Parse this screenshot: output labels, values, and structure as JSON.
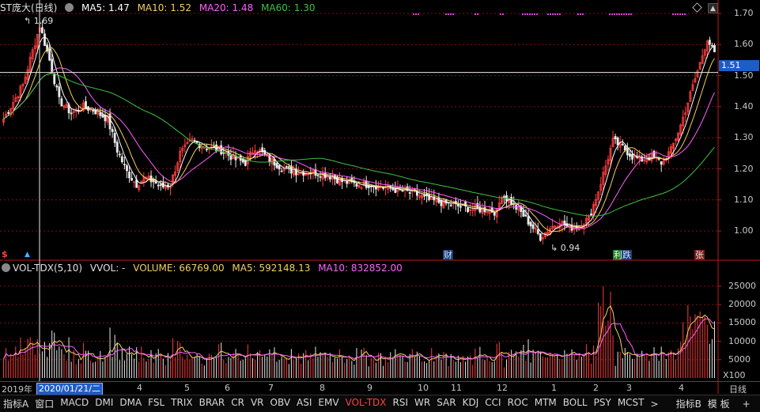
{
  "main_header": {
    "stock": "ST庞大(日线)",
    "ma5": "MA5: 1.47",
    "ma10": "MA10: 1.52",
    "ma20": "MA20: 1.48",
    "ma60": "MA60: 1.30"
  },
  "price_axis": [
    "1.70",
    "1.60",
    "1.50",
    "1.40",
    "1.30",
    "1.20",
    "1.10",
    "1.00"
  ],
  "current_price": "1.51",
  "annotations": {
    "high": "1.69",
    "low": "0.94"
  },
  "markers": {
    "dollar": "$",
    "arrow": "▲",
    "cai": "财",
    "li": "利",
    "die": "跌",
    "zhang": "张"
  },
  "vol_header": {
    "name": "VOL-TDX(5,10)",
    "vvol": "VVOL: -",
    "volume": "VOLUME: 66769.00",
    "ma5": "MA5: 592148.13",
    "ma10": "MA10: 832852.00"
  },
  "vol_axis": [
    "25000",
    "20000",
    "15000",
    "10000",
    "5000"
  ],
  "vol_unit": "X100",
  "date_axis": {
    "year": "2019年",
    "cursor": "2020/01/21/二",
    "months": [
      "4",
      "5",
      "6",
      "7",
      "8",
      "9",
      "10",
      "11",
      "12",
      "1",
      "2",
      "3",
      "4"
    ],
    "period": "日线"
  },
  "tabs": [
    "指标A",
    "窗口",
    "MACD",
    "DMI",
    "DMA",
    "FSL",
    "TRIX",
    "BRAR",
    "CR",
    "VR",
    "OBV",
    "ASI",
    "EMV",
    "VOL-TDX",
    "RSI",
    "WR",
    "SAR",
    "KDJ",
    "CCI",
    "ROC",
    "MTM",
    "BOLL",
    "PSY",
    "MCST"
  ],
  "active_tab": "VOL-TDX",
  "tab_more": ">",
  "right_tabs": {
    "indicator_b": "指标B",
    "template": "模 板",
    "plus": "+",
    "minus": "−"
  },
  "colors": {
    "up": "#ff3c3c",
    "down": "#e8e8e8",
    "ma5": "#ffffff",
    "ma10": "#f0d060",
    "ma20": "#ff60ff",
    "ma60": "#40c040",
    "grid": "#801010",
    "accent": "#1e5cc8"
  },
  "icons": [
    "diamond-icon",
    "scroll-up-icon",
    "scroll-down-icon"
  ],
  "chart_data": {
    "type": "candlestick",
    "price_range": [
      0.91,
      1.73
    ],
    "volume_range": [
      0,
      28000
    ],
    "keyframes_close": [
      [
        0,
        1.36
      ],
      [
        8,
        1.47
      ],
      [
        12,
        1.58
      ],
      [
        15,
        1.66
      ],
      [
        19,
        1.55
      ],
      [
        23,
        1.42
      ],
      [
        28,
        1.38
      ],
      [
        33,
        1.4
      ],
      [
        37,
        1.39
      ],
      [
        43,
        1.36
      ],
      [
        47,
        1.26
      ],
      [
        51,
        1.19
      ],
      [
        55,
        1.15
      ],
      [
        58,
        1.17
      ],
      [
        62,
        1.16
      ],
      [
        65,
        1.14
      ],
      [
        69,
        1.15
      ],
      [
        73,
        1.25
      ],
      [
        78,
        1.29
      ],
      [
        84,
        1.27
      ],
      [
        90,
        1.26
      ],
      [
        96,
        1.23
      ],
      [
        100,
        1.22
      ],
      [
        104,
        1.27
      ],
      [
        110,
        1.23
      ],
      [
        116,
        1.2
      ],
      [
        122,
        1.19
      ],
      [
        128,
        1.19
      ],
      [
        134,
        1.18
      ],
      [
        140,
        1.16
      ],
      [
        146,
        1.15
      ],
      [
        152,
        1.15
      ],
      [
        158,
        1.14
      ],
      [
        164,
        1.13
      ],
      [
        170,
        1.12
      ],
      [
        176,
        1.1
      ],
      [
        182,
        1.09
      ],
      [
        188,
        1.08
      ],
      [
        194,
        1.07
      ],
      [
        200,
        1.07
      ],
      [
        204,
        1.06
      ],
      [
        206,
        1.12
      ],
      [
        210,
        1.09
      ],
      [
        214,
        1.06
      ],
      [
        218,
        1.02
      ],
      [
        222,
        0.98
      ],
      [
        226,
        1.01
      ],
      [
        230,
        1.03
      ],
      [
        234,
        1.01
      ],
      [
        238,
        1.02
      ],
      [
        242,
        1.04
      ],
      [
        246,
        1.13
      ],
      [
        249,
        1.21
      ],
      [
        252,
        1.29
      ],
      [
        256,
        1.27
      ],
      [
        260,
        1.24
      ],
      [
        264,
        1.23
      ],
      [
        268,
        1.24
      ],
      [
        272,
        1.22
      ],
      [
        276,
        1.26
      ],
      [
        280,
        1.34
      ],
      [
        284,
        1.44
      ],
      [
        288,
        1.54
      ],
      [
        291,
        1.62
      ],
      [
        294,
        1.57
      ]
    ],
    "series": [
      {
        "name": "MA5",
        "value": 1.47
      },
      {
        "name": "MA10",
        "value": 1.52
      },
      {
        "name": "MA20",
        "value": 1.48
      },
      {
        "name": "MA60",
        "value": 1.3
      }
    ]
  }
}
